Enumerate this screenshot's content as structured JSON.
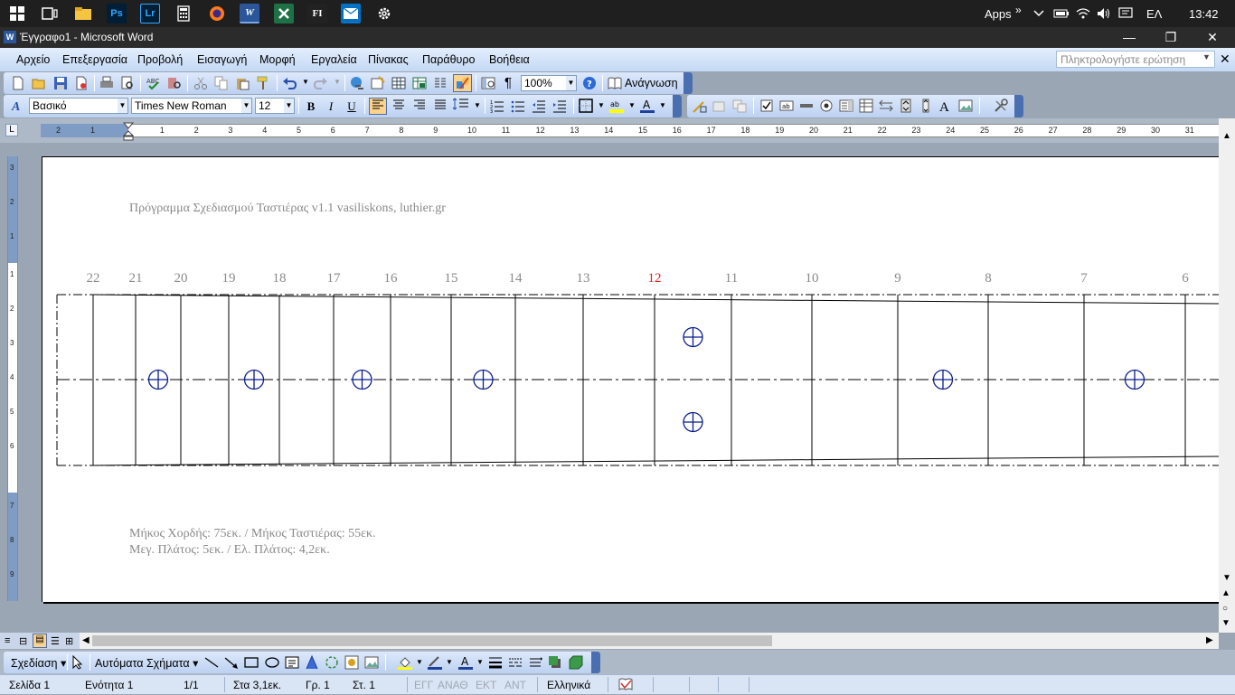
{
  "taskbar": {
    "apps_label": "Apps",
    "chevron": "»",
    "language": "ΕΛ",
    "clock": "13:42",
    "pinned": [
      {
        "name": "windows-start-icon"
      },
      {
        "name": "task-view-icon"
      },
      {
        "name": "file-explorer-icon"
      },
      {
        "name": "photoshop-icon",
        "label": "Ps"
      },
      {
        "name": "lightroom-icon",
        "label": "Lr"
      },
      {
        "name": "calculator-icon"
      },
      {
        "name": "firefox-icon"
      },
      {
        "name": "word-icon",
        "label": "W"
      },
      {
        "name": "excel-icon"
      },
      {
        "name": "fl-studio-icon",
        "label": "FI"
      },
      {
        "name": "outlook-icon"
      },
      {
        "name": "settings-icon"
      }
    ]
  },
  "window": {
    "title": "Έγγραφο1 - Microsoft Word",
    "minimize": "—",
    "restore": "❐",
    "close": "✕"
  },
  "menu": {
    "items": [
      "Αρχείο",
      "Επεξεργασία",
      "Προβολή",
      "Εισαγωγή",
      "Μορφή",
      "Εργαλεία",
      "Πίνακας",
      "Παράθυρο",
      "Βοήθεια"
    ],
    "ask_placeholder": "Πληκτρολογήστε ερώτηση",
    "close_doc": "✕"
  },
  "standard_toolbar": {
    "zoom": "100%",
    "reading_label": "Ανάγνωση"
  },
  "formatting_toolbar": {
    "style": "Βασικό",
    "font": "Times New Roman",
    "size": "12",
    "bold": "B",
    "italic": "I",
    "underline": "U"
  },
  "ruler": {
    "left_numbers": [
      "2",
      "1"
    ],
    "numbers": [
      "1",
      "2",
      "3",
      "4",
      "5",
      "6",
      "7",
      "8",
      "9",
      "10",
      "11",
      "12",
      "13",
      "14",
      "15",
      "16",
      "17",
      "18",
      "19",
      "20",
      "21",
      "22",
      "23",
      "24",
      "25",
      "26",
      "27",
      "28",
      "29",
      "30",
      "31"
    ],
    "vertical_numbers": [
      "3",
      "2",
      "1",
      "1",
      "2",
      "3",
      "4",
      "5",
      "6",
      "7",
      "8",
      "9"
    ]
  },
  "document": {
    "header_line": "Πρόγραμμα Σχεδιασμού Ταστιέρας  v1.1    vasiliskons, luthier.gr",
    "fret_numbers": [
      "22",
      "21",
      "20",
      "19",
      "18",
      "17",
      "16",
      "15",
      "14",
      "13",
      "12",
      "11",
      "10",
      "9",
      "8",
      "7",
      "6"
    ],
    "highlight_fret": "12",
    "highlight_color": "#e0201c",
    "line1": "Μήκος Χορδής: 75εκ. / Μήκος Ταστιέρας: 55εκ.",
    "line2": "Μεγ. Πλάτος: 5εκ. / Ελ. Πλάτος: 4,2εκ.",
    "marker_color": "#0a1e8c"
  },
  "drawing_toolbar": {
    "draw_label": "Σχεδίαση",
    "autoshapes_label": "Αυτόματα Σχήματα"
  },
  "status": {
    "page": "Σελίδα  1",
    "section": "Ενότητα  1",
    "pages": "1/1",
    "position": "Στα  3,1εκ.",
    "line": "Γρ.  1",
    "column": "Στ.  1",
    "rec": "ΕΓΓ",
    "trk": "ΑΝΑΘ",
    "ext": "ΕΚΤ",
    "ovr": "ΑΝΤ",
    "language": "Ελληνικά"
  }
}
